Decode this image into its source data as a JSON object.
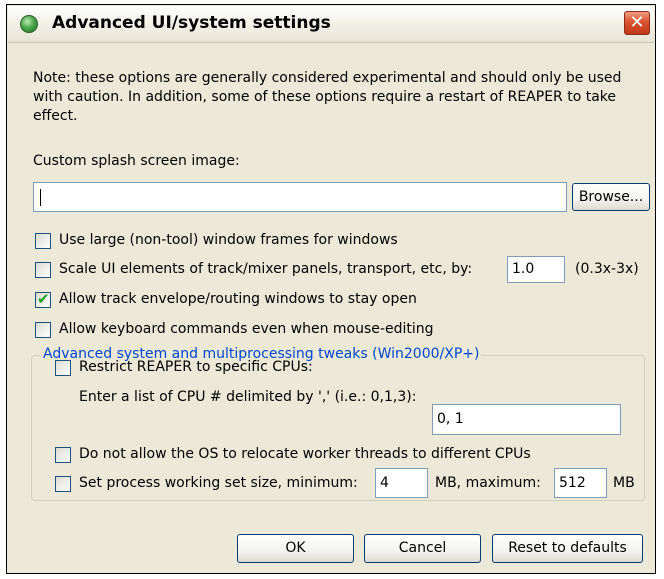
{
  "window": {
    "title": "Advanced UI/system settings",
    "close_glyph": "✕"
  },
  "note": "Note: these options are generally considered experimental and should only be used with caution. In addition, some of these options require a restart of REAPER to take effect.",
  "splash": {
    "label": "Custom splash screen image:",
    "value": "",
    "browse_label": "Browse..."
  },
  "options": {
    "large_frames": {
      "label": "Use large (non-tool) window frames for windows",
      "checked": false
    },
    "scale_ui": {
      "label": "Scale UI elements of track/mixer panels, transport, etc, by:",
      "checked": false,
      "value": "1.0",
      "range_hint": "(0.3x-3x)"
    },
    "stay_open": {
      "label": "Allow track envelope/routing windows to stay open",
      "checked": true
    },
    "keyboard_cmds": {
      "label": "Allow keyboard commands even when mouse-editing",
      "checked": false
    }
  },
  "advanced": {
    "group_label": "Advanced system and multiprocessing tweaks (Win2000/XP+)",
    "restrict_cpus": {
      "label": "Restrict REAPER to specific CPUs:",
      "checked": false
    },
    "cpu_list": {
      "label": "Enter a list of CPU # delimited by ',' (i.e.: 0,1,3):",
      "value": "0, 1"
    },
    "no_relocate": {
      "label": "Do not allow the OS to relocate worker threads to different CPUs",
      "checked": false
    },
    "working_set": {
      "label": "Set process working set size, minimum:",
      "checked": false,
      "min_value": "4",
      "mid_label": "MB, maximum:",
      "max_value": "512",
      "unit": "MB"
    }
  },
  "buttons": {
    "ok": "OK",
    "cancel": "Cancel",
    "reset": "Reset to defaults"
  },
  "icons": {
    "check_glyph": "✔"
  },
  "colors": {
    "group_label": "#0046d5",
    "check_mark": "#21a121",
    "close_button": "#d8532f"
  }
}
